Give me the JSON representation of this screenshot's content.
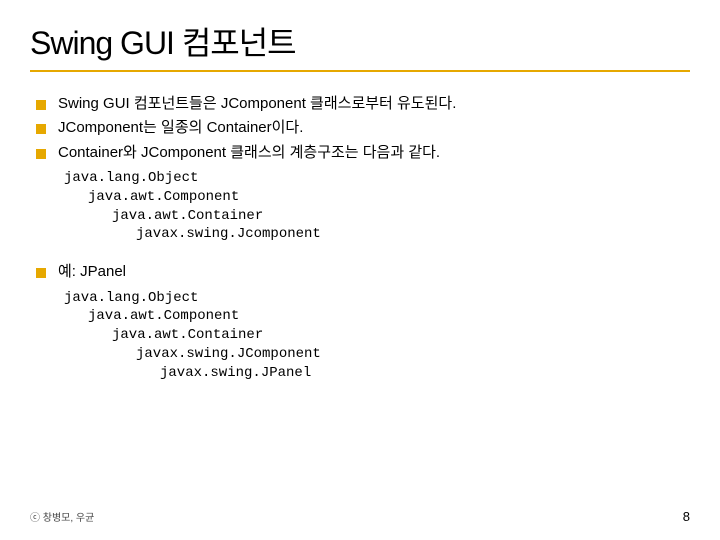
{
  "title": "Swing GUI 컴포넌트",
  "bullets_top": [
    "Swing GUI 컴포넌트들은 JComponent 클래스로부터 유도된다.",
    "JComponent는 일종의 Container이다.",
    "Container와 JComponent 클래스의 계층구조는 다음과 같다."
  ],
  "hierarchy_1": [
    "java.lang.Object",
    "java.awt.Component",
    "java.awt.Container",
    "javax.swing.Jcomponent"
  ],
  "bullet_example": "예: JPanel",
  "hierarchy_2": [
    "java.lang.Object",
    "java.awt.Component",
    "java.awt.Container",
    "javax.swing.JComponent",
    "javax.swing.JPanel"
  ],
  "footer_left": "ⓒ 창병모, 우균",
  "page_number": "8"
}
